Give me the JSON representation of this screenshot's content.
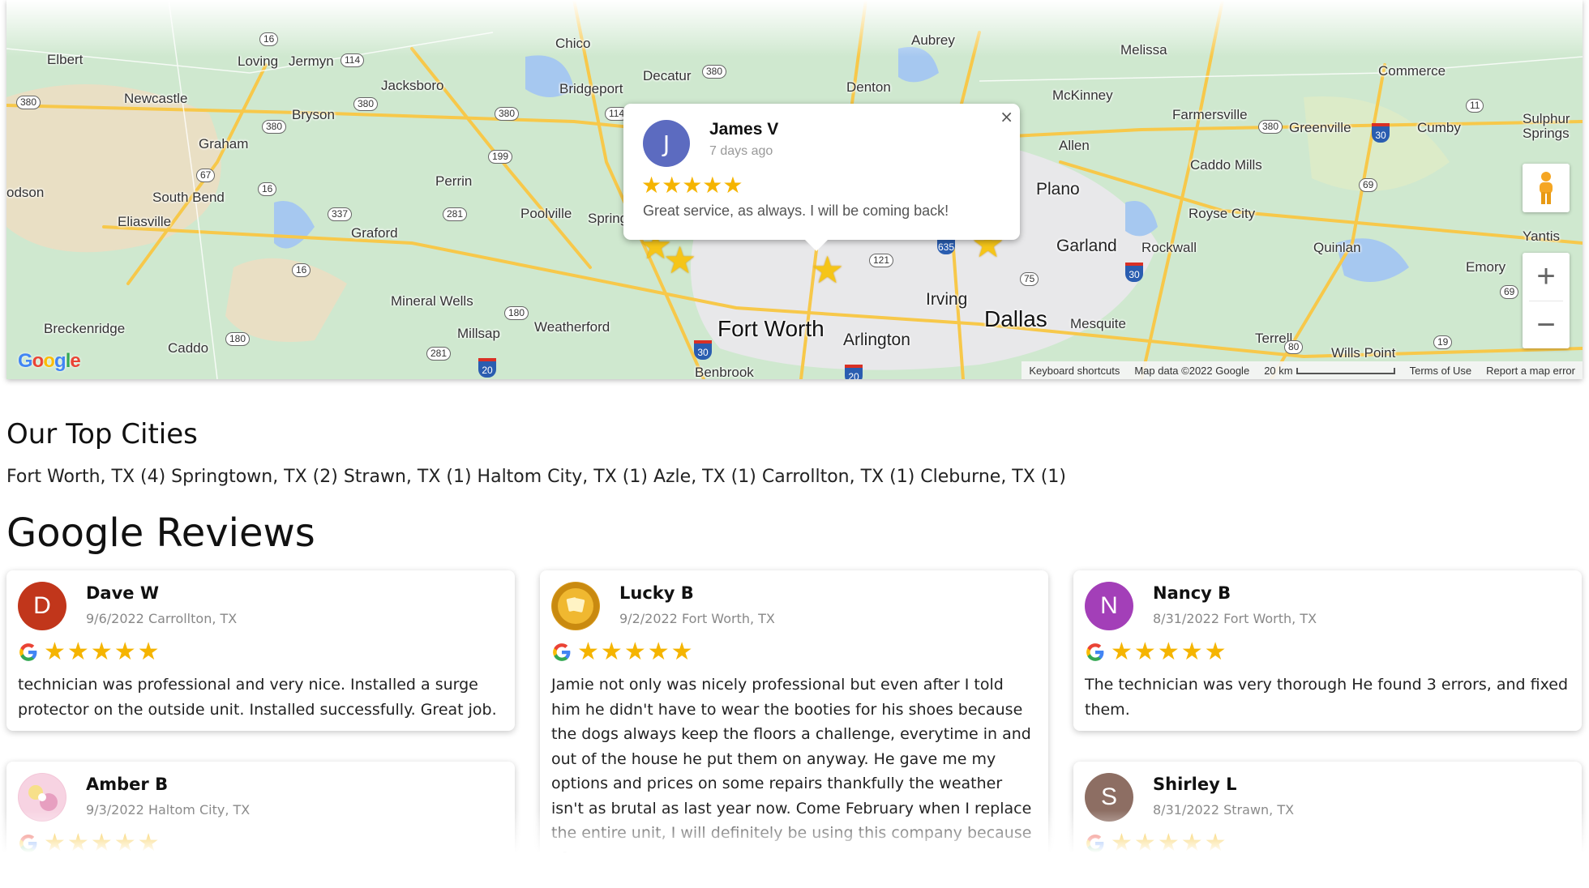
{
  "map": {
    "places": [
      {
        "name": "Elbert",
        "cls": ""
      },
      {
        "name": "Loving",
        "cls": ""
      },
      {
        "name": "Jermyn",
        "cls": ""
      },
      {
        "name": "Chico",
        "cls": ""
      },
      {
        "name": "Aubrey",
        "cls": ""
      },
      {
        "name": "Melissa",
        "cls": ""
      },
      {
        "name": "Commerce",
        "cls": ""
      },
      {
        "name": "Newcastle",
        "cls": ""
      },
      {
        "name": "Jacksboro",
        "cls": ""
      },
      {
        "name": "Bridgeport",
        "cls": ""
      },
      {
        "name": "Decatur",
        "cls": ""
      },
      {
        "name": "Denton",
        "cls": ""
      },
      {
        "name": "McKinney",
        "cls": ""
      },
      {
        "name": "Farmersville",
        "cls": ""
      },
      {
        "name": "Greenville",
        "cls": ""
      },
      {
        "name": "Cumby",
        "cls": ""
      },
      {
        "name": "Sulphur Springs",
        "cls": ""
      },
      {
        "name": "Bryson",
        "cls": ""
      },
      {
        "name": "Graham",
        "cls": ""
      },
      {
        "name": "Allen",
        "cls": ""
      },
      {
        "name": "Caddo Mills",
        "cls": ""
      },
      {
        "name": "odson",
        "cls": ""
      },
      {
        "name": "South Bend",
        "cls": ""
      },
      {
        "name": "Perrin",
        "cls": ""
      },
      {
        "name": "Plano",
        "cls": "med"
      },
      {
        "name": "Royse City",
        "cls": ""
      },
      {
        "name": "Eliasville",
        "cls": ""
      },
      {
        "name": "Graford",
        "cls": ""
      },
      {
        "name": "Poolville",
        "cls": ""
      },
      {
        "name": "Springt",
        "cls": ""
      },
      {
        "name": "Garland",
        "cls": "med"
      },
      {
        "name": "Rockwall",
        "cls": ""
      },
      {
        "name": "Quinlan",
        "cls": ""
      },
      {
        "name": "Yantis",
        "cls": ""
      },
      {
        "name": "Emory",
        "cls": ""
      },
      {
        "name": "Irving",
        "cls": "med"
      },
      {
        "name": "Mineral Wells",
        "cls": ""
      },
      {
        "name": "Weatherford",
        "cls": ""
      },
      {
        "name": "Fort Worth",
        "cls": "big"
      },
      {
        "name": "Dallas",
        "cls": "big"
      },
      {
        "name": "Mesquite",
        "cls": ""
      },
      {
        "name": "Breckenridge",
        "cls": ""
      },
      {
        "name": "Millsap",
        "cls": ""
      },
      {
        "name": "Arlington",
        "cls": "med"
      },
      {
        "name": "Terrell",
        "cls": ""
      },
      {
        "name": "Caddo",
        "cls": ""
      },
      {
        "name": "Wills Point",
        "cls": ""
      },
      {
        "name": "Benbrook",
        "cls": ""
      }
    ],
    "attribution": {
      "shortcuts": "Keyboard shortcuts",
      "data": "Map data ©2022 Google",
      "scale": "20 km",
      "terms": "Terms of Use",
      "report": "Report a map error"
    },
    "zoom_in": "+",
    "zoom_out": "−",
    "popup": {
      "initial": "J",
      "name": "James V",
      "time": "7 days ago",
      "stars": "★★★★★",
      "text": "Great service, as always. I will be coming back!",
      "close": "×"
    }
  },
  "cities": {
    "heading": "Our Top Cities",
    "list": "Fort Worth, TX (4) Springtown, TX (2) Strawn, TX (1) Haltom City, TX (1) Azle, TX (1) Carrollton, TX (1) Cleburne, TX (1)"
  },
  "reviews": {
    "heading": "Google Reviews",
    "items": [
      {
        "initial": "D",
        "name": "Dave W",
        "meta": "9/6/2022 Carrollton, TX",
        "rating": 5,
        "text": "technician was professional and very nice. Installed a surge protector on the outside unit. Installed successfully. Great job.",
        "color": "#c1361b"
      },
      {
        "initial": "",
        "name": "Lucky B",
        "meta": "9/2/2022 Fort Worth, TX",
        "rating": 5,
        "text": "Jamie not only was nicely professional but even after I told him he didn't have to wear the booties for his shoes because the dogs always keep the floors a challenge, everytime in and out of the house he put them on anyway. He gave me my options and prices on some repairs thankfully the weather isn't as brutal as last year now. Come February when I replace the entire unit, I will definitely be using this company because of",
        "color": "#d89a1c"
      },
      {
        "initial": "N",
        "name": "Nancy B",
        "meta": "8/31/2022 Fort Worth, TX",
        "rating": 5,
        "text": "The technician was very thorough He found 3 errors, and fixed them.",
        "color": "#a33fb8"
      },
      {
        "initial": "",
        "name": "Amber B",
        "meta": "9/3/2022 Haltom City, TX",
        "rating": 5,
        "text": "",
        "color": "#f3c6d8"
      },
      {
        "initial": "S",
        "name": "Shirley L",
        "meta": "8/31/2022 Strawn, TX",
        "rating": 5,
        "text": "",
        "color": "#8d6e63"
      }
    ]
  }
}
